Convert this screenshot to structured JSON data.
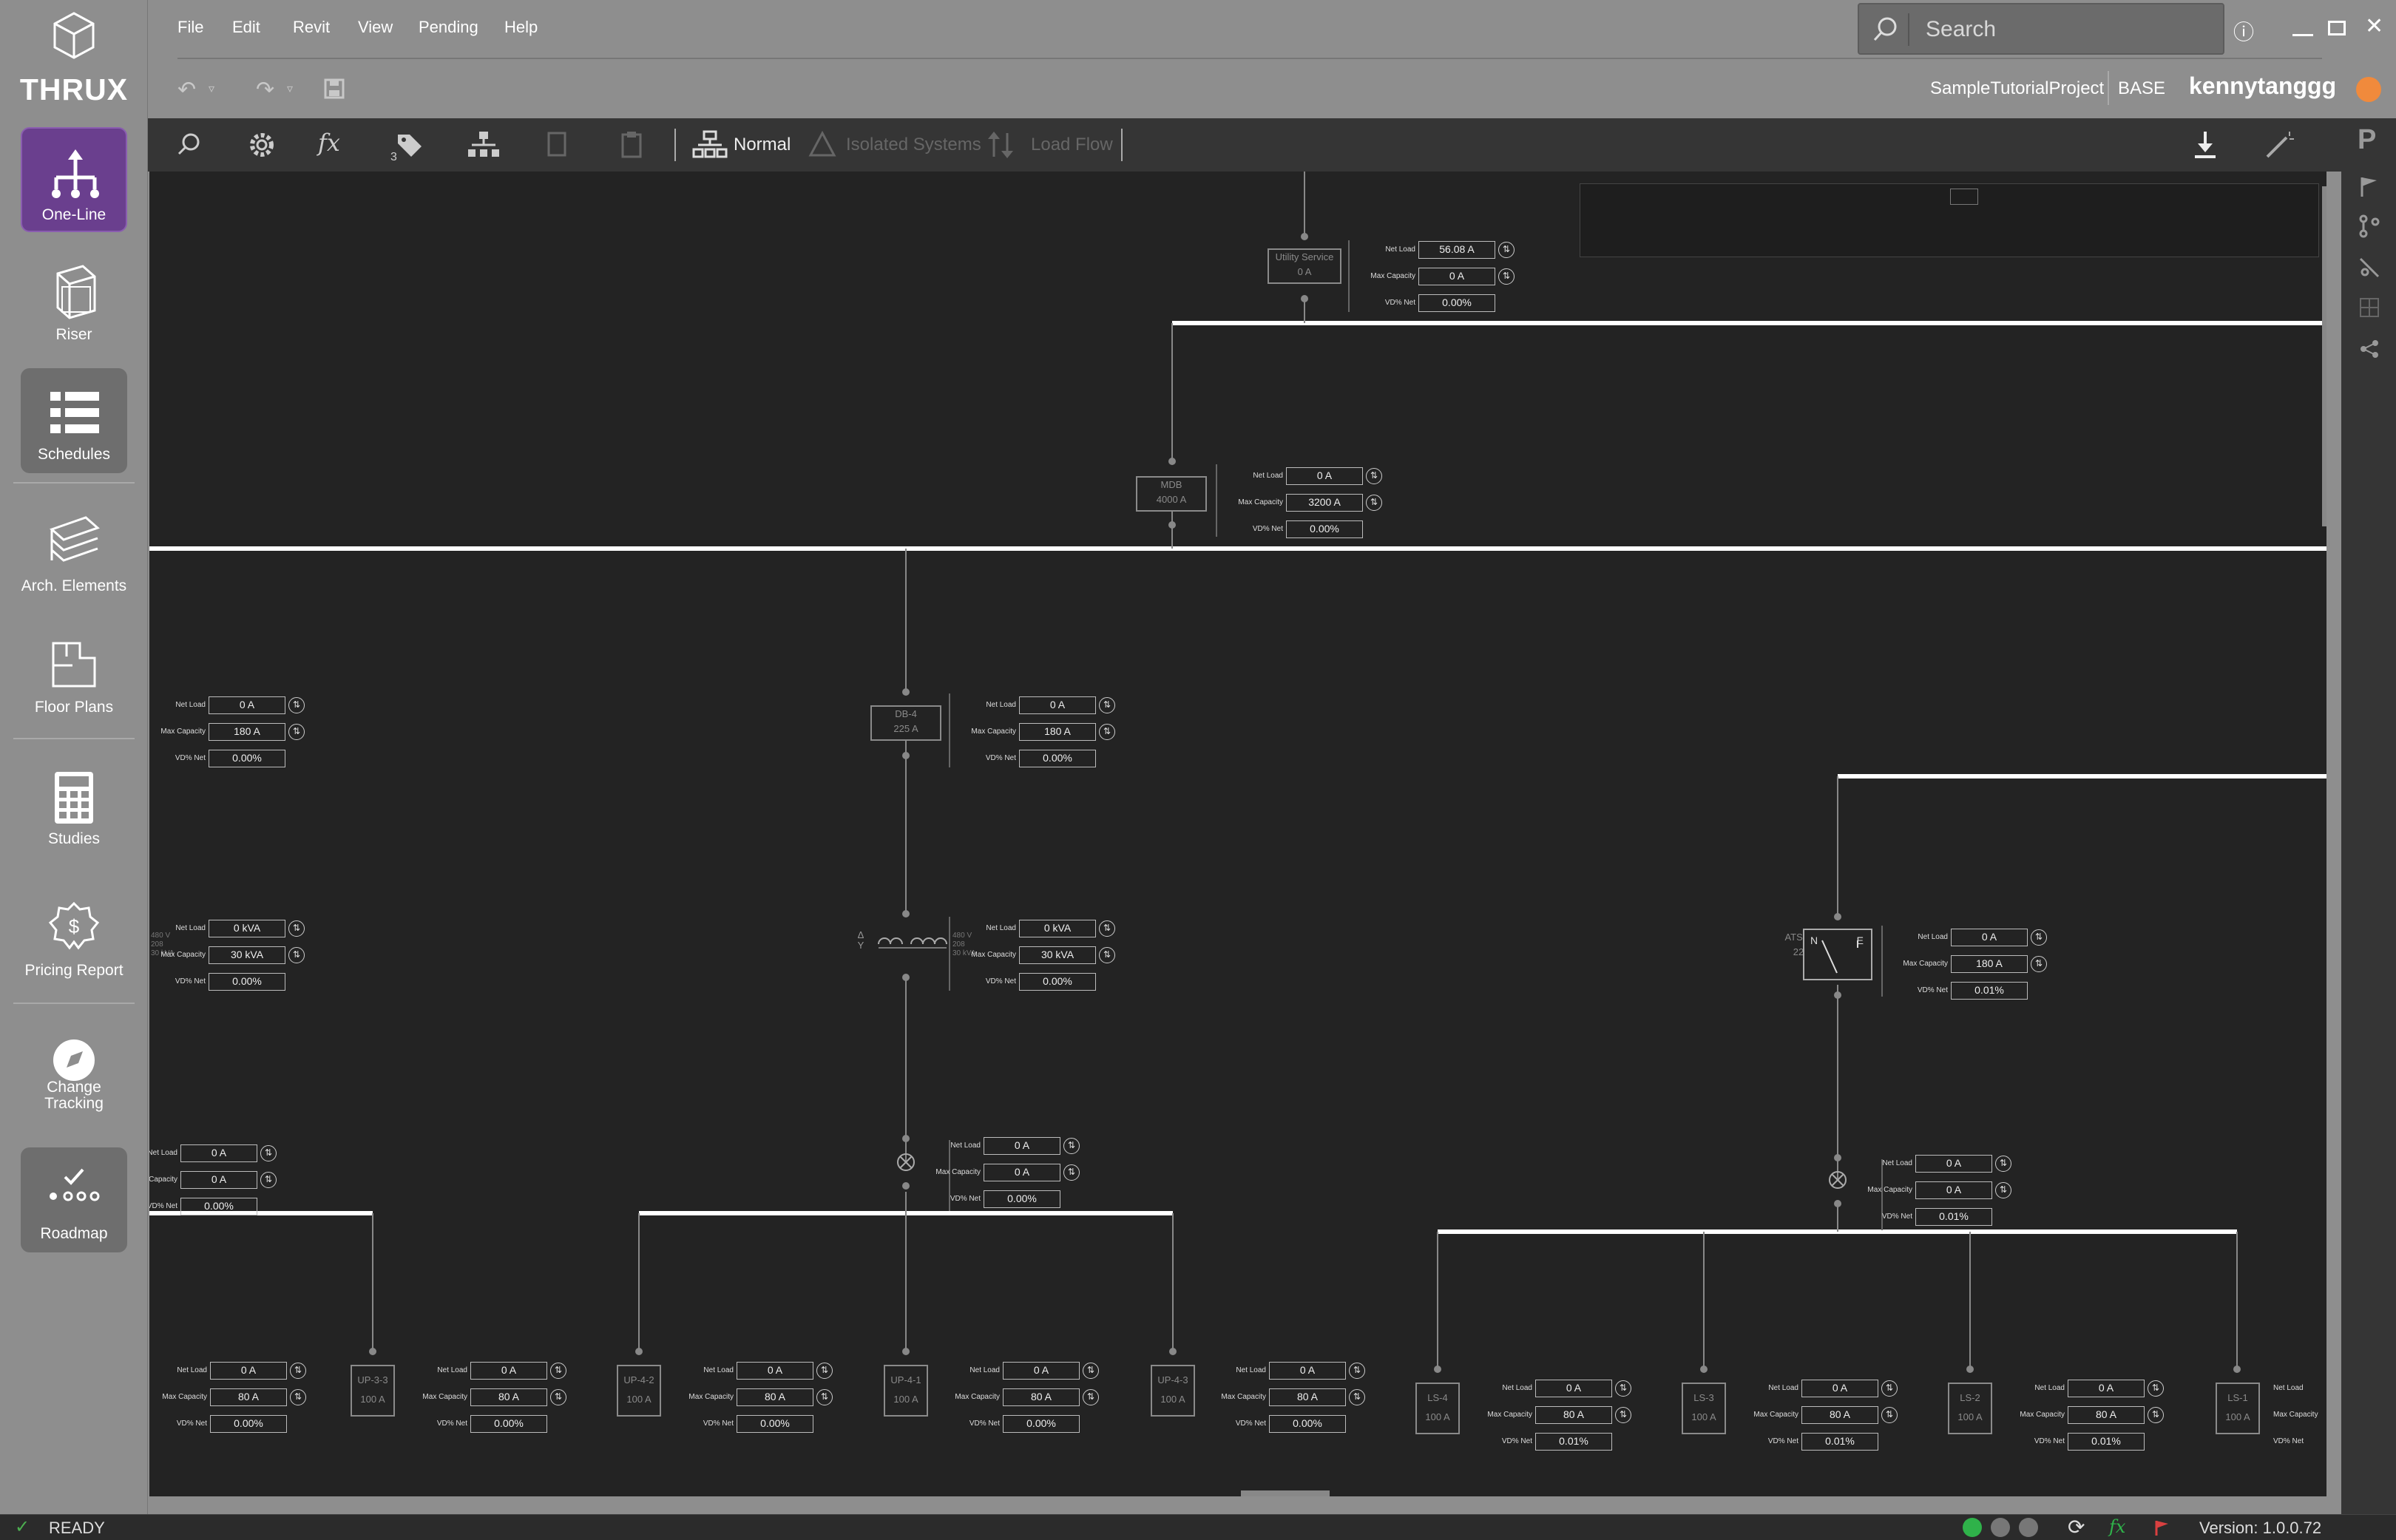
{
  "app": {
    "logo_text": "THRUX",
    "project_name": "SampleTutorialProject",
    "branch": "BASE",
    "user": "kennytanggg",
    "status": "READY",
    "version": "Version: 1.0.0.72"
  },
  "menu": [
    "File",
    "Edit",
    "Revit",
    "View",
    "Pending",
    "Help"
  ],
  "search": {
    "placeholder": "Search"
  },
  "nav": [
    {
      "label": "One-Line",
      "icon": "one-line-icon"
    },
    {
      "label": "Riser",
      "icon": "cube-icon"
    },
    {
      "label": "Schedules",
      "icon": "list-icon"
    },
    {
      "label": "Arch. Elements",
      "icon": "layers-icon"
    },
    {
      "label": "Floor Plans",
      "icon": "floorplan-icon"
    },
    {
      "label": "Studies",
      "icon": "calculator-icon"
    },
    {
      "label": "Pricing Report",
      "icon": "pricing-icon"
    },
    {
      "label": "Change Tracking",
      "icon": "compass-icon"
    },
    {
      "label": "Roadmap",
      "icon": "roadmap-icon"
    }
  ],
  "toolbar": {
    "tag_count": "3",
    "mode_normal": "Normal",
    "mode_isolated": "Isolated Systems",
    "mode_loadflow": "Load Flow"
  },
  "labels": {
    "net_load": "Net Load",
    "max_capacity": "Max Capacity",
    "vd_net": "VD% Net"
  },
  "nodes": {
    "utility": {
      "name": "Utility Service",
      "rating": "0 A",
      "net": "56.08 A",
      "max": "0 A",
      "vd": "0.00%"
    },
    "mdb": {
      "name": "MDB",
      "rating": "4000 A",
      "net": "0 A",
      "max": "3200 A",
      "vd": "0.00%"
    },
    "left_db": {
      "net": "0 A",
      "max": "180 A",
      "vd": "0.00%"
    },
    "db4": {
      "name": "DB-4",
      "rating": "225 A",
      "net": "0 A",
      "max": "180 A",
      "vd": "0.00%"
    },
    "left_xfmr": {
      "net": "0 kVA",
      "max": "30 kVA",
      "vd": "0.00%",
      "v1": "480 V",
      "v2": "208",
      "v3": "30 kVA"
    },
    "xfmr4": {
      "net": "0 kVA",
      "max": "30 kVA",
      "vd": "0.00%",
      "v1": "480 V",
      "v2": "208",
      "v3": "30 kVA",
      "mark": "Δ Y"
    },
    "left_panel": {
      "net": "0 A",
      "max": "0 A",
      "vd": "0.00%"
    },
    "panel4": {
      "net": "0 A",
      "max": "0 A",
      "vd": "0.00%"
    },
    "ats": {
      "name": "ATS-LS",
      "rating": "225 A",
      "net": "0 A",
      "max": "180 A",
      "vd": "0.01%",
      "n": "N",
      "e": "E"
    },
    "ats_panel": {
      "net": "0 A",
      "max": "0 A",
      "vd": "0.01%"
    },
    "left_edge": {
      "net": "0 A",
      "max": "80 A",
      "vd": "0.00%"
    },
    "up33": {
      "name": "UP-3-3",
      "rating": "100 A",
      "net": "0 A",
      "max": "80 A",
      "vd": "0.00%"
    },
    "up42": {
      "name": "UP-4-2",
      "rating": "100 A",
      "net": "0 A",
      "max": "80 A",
      "vd": "0.00%"
    },
    "up41": {
      "name": "UP-4-1",
      "rating": "100 A",
      "net": "0 A",
      "max": "80 A",
      "vd": "0.00%"
    },
    "up43": {
      "name": "UP-4-3",
      "rating": "100 A",
      "net": "0 A",
      "max": "80 A",
      "vd": "0.00%"
    },
    "ls4": {
      "name": "LS-4",
      "rating": "100 A",
      "net": "0 A",
      "max": "80 A",
      "vd": "0.01%"
    },
    "ls3": {
      "name": "LS-3",
      "rating": "100 A",
      "net": "0 A",
      "max": "80 A",
      "vd": "0.01%"
    },
    "ls2": {
      "name": "LS-2",
      "rating": "100 A",
      "net": "0 A",
      "max": "80 A",
      "vd": "0.01%"
    },
    "ls1": {
      "name": "LS-1",
      "rating": "100 A"
    }
  },
  "right_panel": {
    "label": "P"
  },
  "colors": {
    "accent": "#6a3f8e",
    "canvas": "#232323",
    "green": "#4caf50",
    "bus": "#ffffff"
  }
}
